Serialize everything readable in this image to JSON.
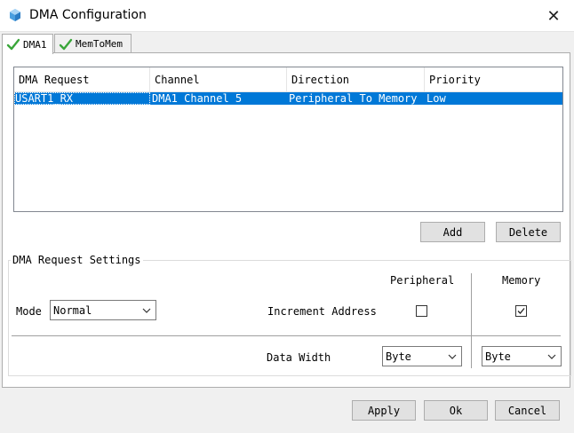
{
  "window": {
    "title": "DMA Configuration",
    "close_glyph": "✕"
  },
  "tabs": [
    {
      "label": "DMA1",
      "icon": "check-icon",
      "active": true
    },
    {
      "label": "MemToMem",
      "icon": "check-icon",
      "active": false
    }
  ],
  "table": {
    "columns": [
      "DMA Request",
      "Channel",
      "Direction",
      "Priority"
    ],
    "rows": [
      [
        "USART1_RX",
        "DMA1 Channel 5",
        "Peripheral To Memory",
        "Low"
      ]
    ],
    "selected_row": 0
  },
  "table_buttons": {
    "add": "Add",
    "delete": "Delete"
  },
  "settings": {
    "group_title": "DMA Request Settings",
    "mode_label": "Mode",
    "mode_value": "Normal",
    "col_peripheral": "Peripheral",
    "col_memory": "Memory",
    "increment_label": "Increment Address",
    "increment_peripheral": false,
    "increment_memory": true,
    "data_width_label": "Data Width",
    "data_width_peripheral": "Byte",
    "data_width_memory": "Byte"
  },
  "footer": {
    "apply": "Apply",
    "ok": "Ok",
    "cancel": "Cancel"
  },
  "colors": {
    "selection": "#0078d7",
    "accent_check": "#3aa63a",
    "app_icon": "#4a9fe0"
  }
}
